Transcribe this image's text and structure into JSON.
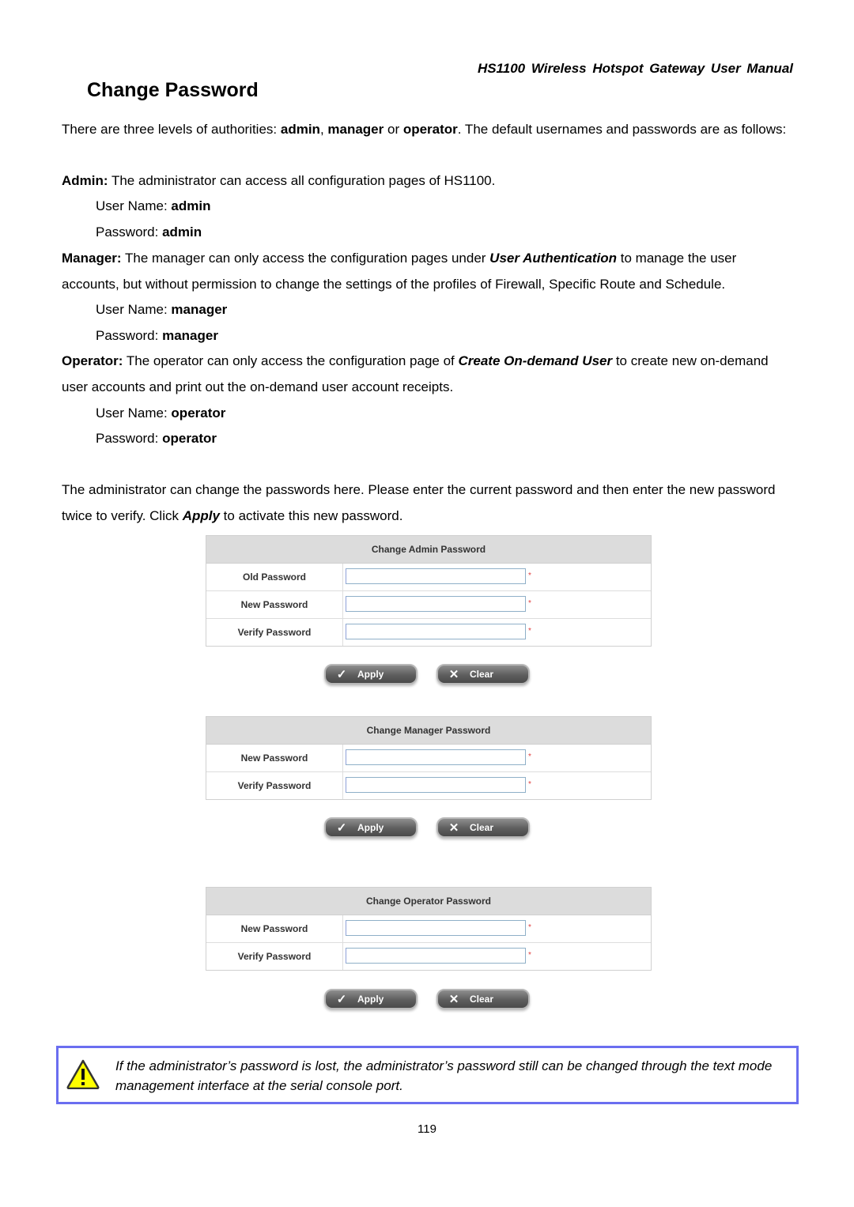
{
  "header": {
    "running_title": "HS1100  Wireless  Hotspot  Gateway  User  Manual"
  },
  "page_title": "Change Password",
  "intro": {
    "pre": "There are three levels of authorities: ",
    "r1": "admin",
    "sep1": ", ",
    "r2": "manager",
    "sep2": " or ",
    "r3": "operator",
    "post": ". The default usernames and passwords are as follows:"
  },
  "roles": [
    {
      "label": "Admin:",
      "desc_pre": " The administrator can access all configuration pages of HS1100.",
      "desc_em": "",
      "desc_post": "",
      "username_label": "User Name: ",
      "username": "admin",
      "password_label": "Password: ",
      "password": "admin"
    },
    {
      "label": "Manager:",
      "desc_pre": " The manager can only access the configuration pages under ",
      "desc_em": "User Authentication",
      "desc_post": " to manage the user accounts, but without permission to change the settings of the profiles of Firewall, Specific Route and Schedule.",
      "username_label": "User Name: ",
      "username": "manager",
      "password_label": "Password: ",
      "password": "manager"
    },
    {
      "label": "Operator:",
      "desc_pre": " The operator can only access the configuration page of ",
      "desc_em": "Create On-demand User",
      "desc_post": " to create new on-demand user accounts and print out the on-demand user account receipts.",
      "username_label": "User Name: ",
      "username": "operator",
      "password_label": "Password: ",
      "password": "operator"
    }
  ],
  "instructions": {
    "pre": "The administrator can change the passwords here. Please enter the current password and then enter the new password twice to verify. Click ",
    "em": "Apply",
    "post": " to activate this new password."
  },
  "forms": [
    {
      "title": "Change Admin Password",
      "fields": [
        {
          "label": "Old Password",
          "value": "",
          "required_mark": "*"
        },
        {
          "label": "New Password",
          "value": "",
          "required_mark": "*"
        },
        {
          "label": "Verify Password",
          "value": "",
          "required_mark": "*"
        }
      ],
      "apply_label": "Apply",
      "clear_label": "Clear"
    },
    {
      "title": "Change Manager Password",
      "fields": [
        {
          "label": "New Password",
          "value": "",
          "required_mark": "*"
        },
        {
          "label": "Verify Password",
          "value": "",
          "required_mark": "*"
        }
      ],
      "apply_label": "Apply",
      "clear_label": "Clear"
    },
    {
      "title": "Change Operator Password",
      "fields": [
        {
          "label": "New Password",
          "value": "",
          "required_mark": "*"
        },
        {
          "label": "Verify Password",
          "value": "",
          "required_mark": "*"
        }
      ],
      "apply_label": "Apply",
      "clear_label": "Clear"
    }
  ],
  "icons": {
    "apply": "checkmark-icon",
    "clear": "x-icon",
    "note": "warning-icon"
  },
  "note": {
    "text": "If the administrator’s password is lost, the administrator’s password still can be changed through the text mode management interface at the serial console port."
  },
  "colors": {
    "note_border": "#6a6ef0",
    "warning_fill": "#ffff00",
    "required_mark": "#e04040",
    "panel_header": "#dcdcdc"
  },
  "footer": {
    "page_number": "119"
  }
}
